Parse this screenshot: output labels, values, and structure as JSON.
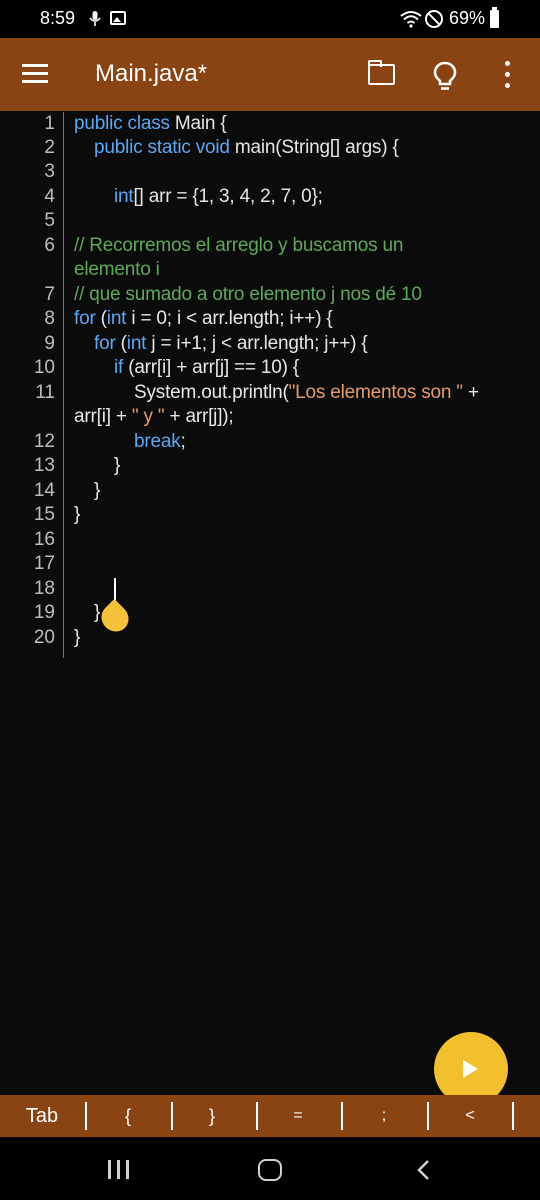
{
  "status_bar": {
    "time": "8:59",
    "battery": "69%",
    "icons": [
      "mic-icon",
      "gallery-icon",
      "wifi-icon",
      "do-not-disturb-icon",
      "battery-icon"
    ]
  },
  "toolbar": {
    "title": "Main.java*",
    "icons": [
      "menu-icon",
      "folder-icon",
      "lightbulb-icon",
      "more-vert-icon"
    ],
    "color": "#8a4413"
  },
  "editor": {
    "line_numbers": [
      "1",
      "2",
      "3",
      "4",
      "5",
      "6",
      "7",
      "8",
      "9",
      "10",
      "11",
      "12",
      "13",
      "14",
      "15",
      "16",
      "17",
      "18",
      "19",
      "20"
    ],
    "cursor_line": "19"
  },
  "code": {
    "l1_kw": "public class",
    "l1_rest": " Main {",
    "l2_kw": "public static void",
    "l2_rest": " main(String[] args) {",
    "l4_kw": "int",
    "l4_rest": "[] arr = {1, 3, 4, 2, 7, 0};",
    "l6_comment_a": "// Recorremos el arreglo y buscamos un",
    "l6_comment_b": "elemento i",
    "l7_comment": "// que sumado a otro elemento j nos dé 10",
    "l8_kw1": "for",
    "l8_mid": " (",
    "l8_kw2": "int",
    "l8_rest": " i = 0; i < arr.length; i++) {",
    "l9_kw1": "for",
    "l9_mid": " (",
    "l9_kw2": "int",
    "l9_rest": " j = i+1; j < arr.length; j++) {",
    "l10_kw": "if",
    "l10_rest": " (arr[i] + arr[j] == 10) {",
    "l11_a": "System.out.println(",
    "l11_str": "\"Los elementos son \"",
    "l11_b": " +",
    "l11_cont_a": "arr[i] + ",
    "l11_cont_str": "\" y \"",
    "l11_cont_b": " + arr[j]);",
    "l12_kw": "break",
    "l12_rest": ";",
    "l13": "}",
    "l14": "}",
    "l15": "}",
    "l19": "}",
    "l20": "}"
  },
  "fab": {
    "icon": "play-icon",
    "color": "#f2bf2d"
  },
  "keybar": {
    "keys": [
      "Tab",
      "{",
      "}",
      "=",
      ";",
      "<"
    ]
  },
  "navbar": {
    "icons": [
      "recents-icon",
      "home-icon",
      "back-icon"
    ]
  }
}
